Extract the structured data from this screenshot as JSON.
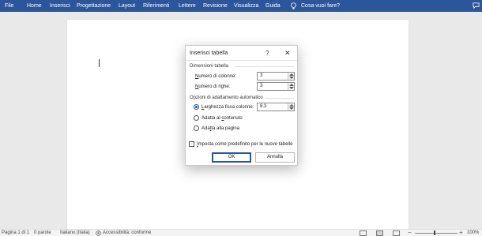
{
  "ribbon": {
    "tabs": [
      "File",
      "Home",
      "Inserisci",
      "Progettazione",
      "Layout",
      "Riferimenti",
      "Lettere",
      "Revisione",
      "Visualizza",
      "Guida"
    ],
    "tell_me": "Cosa vuoi fare?",
    "colors": {
      "bar": "#2b579a",
      "text": "#ffffff"
    },
    "icons": {
      "tell_me": "lightbulb-icon",
      "comments": "comment-icon"
    }
  },
  "dialog": {
    "title": "Inserisci tabella",
    "help": "?",
    "close": "✕",
    "size_group": "Dimensioni tabella",
    "columns_label_u": "N",
    "columns_label": "umero di colonne:",
    "columns_value": "3",
    "rows_label_u": "N",
    "rows_label": "umero di righe:",
    "rows_value": "3",
    "autofit_group": "Opzioni di adattamento automatico",
    "fixed_label_u": "L",
    "fixed_label": "arghezza fissa colonne:",
    "fixed_value": "8.3",
    "fit_content_pre": "Adatta al ",
    "fit_content_u": "c",
    "fit_content_post": "ontenuto",
    "fit_window_pre": "Ada",
    "fit_window_u": "t",
    "fit_window_post": "ta alla pagina",
    "selected_option": "fixed",
    "remember_u": "I",
    "remember_label": "mposta come predefinito per le nuove tabelle",
    "remember_checked": false,
    "ok": "OK",
    "cancel": "Annulla"
  },
  "status": {
    "page": "Pagina 1 di 1",
    "words": "0 parole",
    "language": "Italiano (Italia)",
    "accessibility": "Accessibilità: conforme",
    "zoom": "100%",
    "zoom_fraction": 0.5,
    "icons": {
      "accessibility": "accessibility-icon",
      "read_mode": "read-mode-icon",
      "print_layout": "print-layout-icon",
      "web_layout": "web-layout-icon"
    }
  }
}
